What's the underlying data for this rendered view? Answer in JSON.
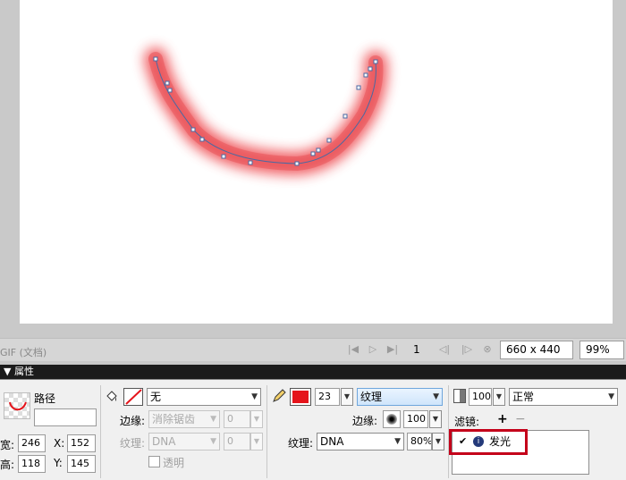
{
  "statusbar": {
    "doc_label": "GIF (文档)",
    "frame_number": "1",
    "size": "660 x 440",
    "zoom": "99%"
  },
  "props": {
    "header_title": "▼ 属性",
    "object_type": "路径",
    "width_label": "宽:",
    "width_value": "246",
    "height_label": "高:",
    "height_value": "118",
    "x_label": "X:",
    "x_value": "152",
    "y_label": "Y:",
    "y_value": "145",
    "fill": {
      "type": "无",
      "edge_label": "边缘:",
      "edge_value": "消除锯齿",
      "edge_amount": "0",
      "texture_label": "纹理:",
      "texture_value": "DNA",
      "texture_amount": "0",
      "transparent_label": "透明"
    },
    "stroke": {
      "color": "#e5141b",
      "size": "23",
      "category": "纹理",
      "edge_label": "边缘:",
      "edge_value": "100",
      "texture_label": "纹理:",
      "texture_value": "DNA",
      "texture_amount": "80%"
    },
    "opacity": "100",
    "blend_mode": "正常",
    "filters_label": "滤镜:",
    "add_label": "+",
    "remove_label": "−",
    "filter_items": [
      {
        "name": "发光",
        "checked": true
      }
    ]
  },
  "colors": {
    "glow": "#f05a5f",
    "path_point": "#5b6fa8"
  }
}
